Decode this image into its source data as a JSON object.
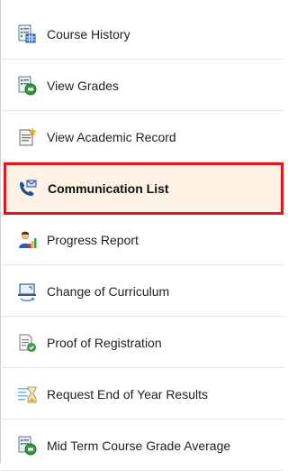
{
  "menu": {
    "items": [
      {
        "label": "Course History",
        "icon": "course-history-icon",
        "active": false
      },
      {
        "label": "View Grades",
        "icon": "view-grades-icon",
        "active": false
      },
      {
        "label": "View Academic Record",
        "icon": "academic-record-icon",
        "active": false
      },
      {
        "label": "Communication List",
        "icon": "communication-icon",
        "active": true
      },
      {
        "label": "Progress Report",
        "icon": "progress-report-icon",
        "active": false
      },
      {
        "label": "Change of Curriculum",
        "icon": "change-curriculum-icon",
        "active": false
      },
      {
        "label": "Proof of Registration",
        "icon": "proof-registration-icon",
        "active": false
      },
      {
        "label": "Request End of Year Results",
        "icon": "year-results-icon",
        "active": false
      },
      {
        "label": "Mid Term Course Grade Average",
        "icon": "grade-average-icon",
        "active": false
      }
    ],
    "colors": {
      "active_border": "#e2141e",
      "active_background": "#fdf2e4"
    }
  }
}
